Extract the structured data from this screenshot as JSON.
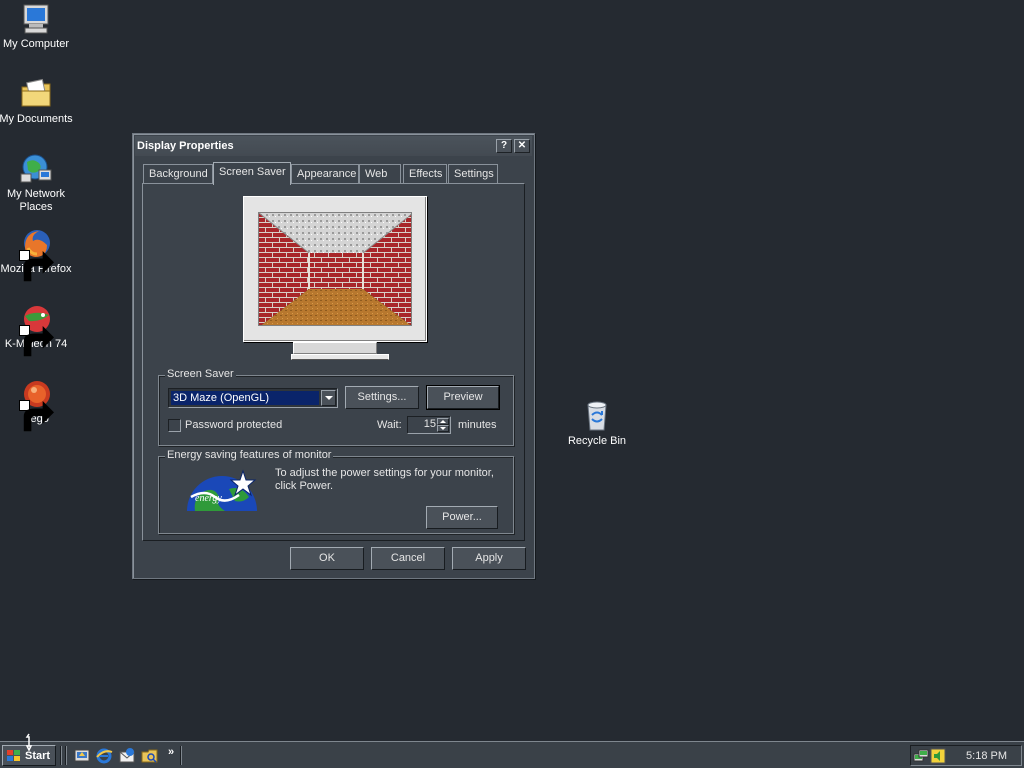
{
  "desktop": {
    "icons": [
      {
        "label": "My Computer",
        "icon": "my-computer-icon"
      },
      {
        "label": "My Documents",
        "icon": "my-documents-icon"
      },
      {
        "label": "My Network Places",
        "icon": "network-places-icon"
      },
      {
        "label": "Mozilla Firefox",
        "icon": "firefox-icon"
      },
      {
        "label": "K-Meleon 74",
        "icon": "kmeleon-icon"
      },
      {
        "label": "Pego",
        "icon": "pego-icon"
      },
      {
        "label": "Recycle Bin",
        "icon": "recycle-bin-icon"
      }
    ]
  },
  "dialog": {
    "title": "Display Properties",
    "help_button": "?",
    "close_button": "✕",
    "tabs": [
      "Background",
      "Screen Saver",
      "Appearance",
      "Web",
      "Effects",
      "Settings"
    ],
    "active_tab": "Screen Saver",
    "screensaver": {
      "group_label": "Screen Saver",
      "selected": "3D Maze (OpenGL)",
      "settings_button": "Settings...",
      "preview_button": "Preview",
      "password_label": "Password protected",
      "password_checked": false,
      "wait_label": "Wait:",
      "wait_value": "15",
      "wait_unit": "minutes"
    },
    "energy": {
      "group_label": "Energy saving features of monitor",
      "description": "To adjust the power settings for your monitor, click Power.",
      "power_button": "Power...",
      "logo_icon": "energy-star-logo"
    },
    "buttons": {
      "ok": "OK",
      "cancel": "Cancel",
      "apply": "Apply"
    }
  },
  "taskbar": {
    "start_label": "Start",
    "quick_launch": [
      "show-desktop-icon",
      "internet-explorer-icon",
      "outlook-express-icon",
      "explorer-icon"
    ],
    "chevron": "»",
    "clock": "5:18 PM"
  },
  "colors": {
    "desktop": "#252a31",
    "dialog": "#3c434b",
    "selection": "#0a246a"
  }
}
